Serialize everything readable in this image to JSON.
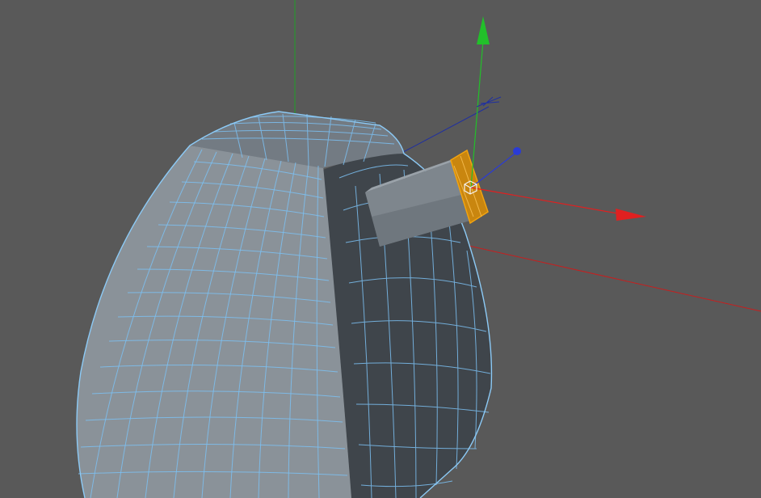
{
  "viewport": {
    "background_color": "#595959",
    "mesh_fill_color": "#8a9299",
    "mesh_dark_fill_color": "#3f454b",
    "wireframe_color": "#7cc0f2",
    "selection_color": "#f2a30f"
  },
  "gizmo": {
    "x_axis_color": "#e02020",
    "y_axis_color": "#22c02a",
    "z_axis_color": "#2a3bd6",
    "pivot_icon": "object-axis-cube-icon"
  },
  "world_axes": {
    "x_color": "#c81e1e",
    "y_color": "#1fa028",
    "z_color": "#2030a0"
  }
}
